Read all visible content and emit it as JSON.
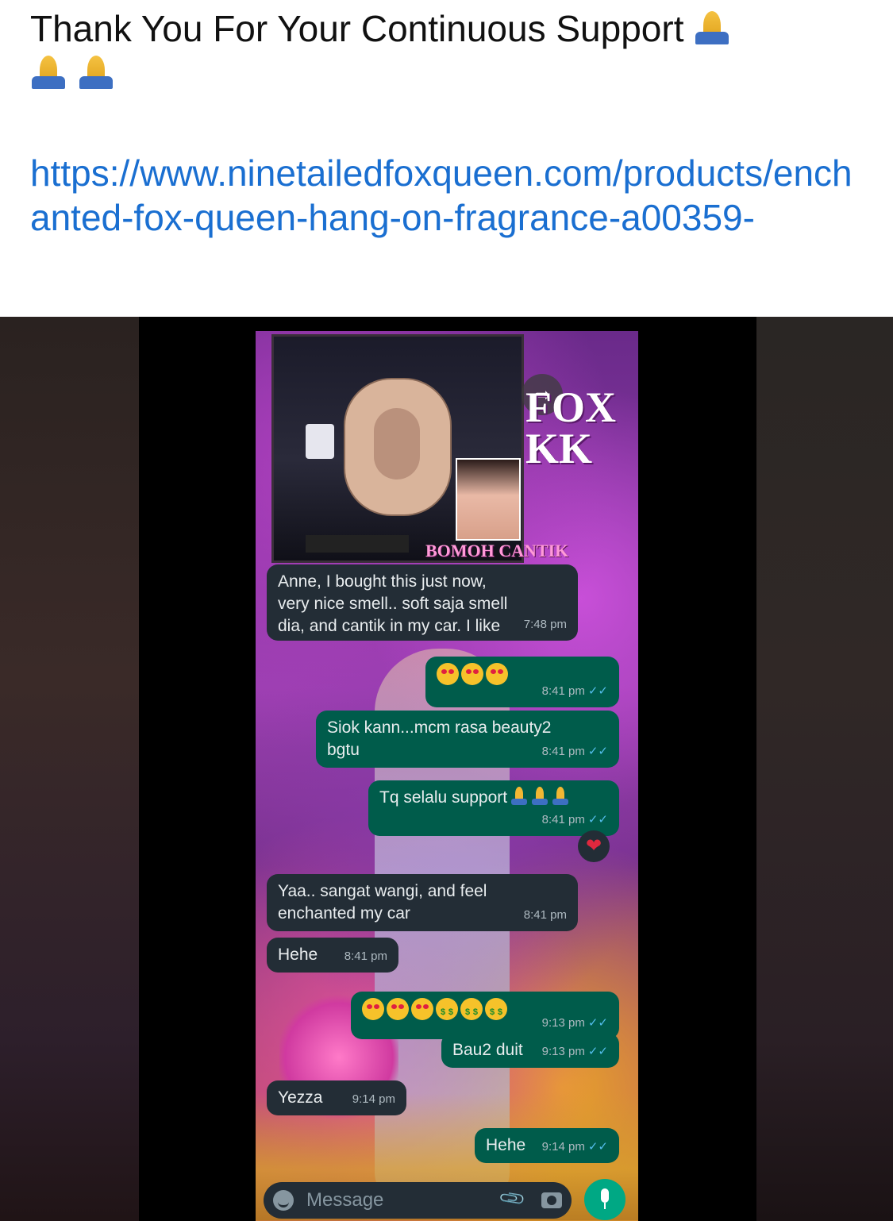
{
  "post": {
    "caption": "Thank You For Your Continuous Support",
    "link": "https://www.ninetailedfoxqueen.com/products/enchanted-fox-queen-hang-on-fragrance-a00359-"
  },
  "overlay": {
    "fox_title_1": "FOX",
    "fox_title_2": "KK",
    "brand": "BOMOH CANTIK"
  },
  "messages": [
    {
      "side": "in",
      "text": "Anne, I bought this just now, very nice smell.. soft saja smell dia, and cantik in my car. I like",
      "time": "7:48 pm"
    },
    {
      "side": "out",
      "text": "",
      "time": "8:41 pm"
    },
    {
      "side": "out",
      "text": "Siok kann...mcm rasa beauty2 bgtu",
      "time": "8:41 pm"
    },
    {
      "side": "out",
      "text": "Tq selalu support",
      "time": "8:41 pm"
    },
    {
      "side": "in",
      "text": "Yaa..  sangat wangi, and feel enchanted my car",
      "time": "8:41 pm"
    },
    {
      "side": "in",
      "text": "Hehe",
      "time": "8:41 pm"
    },
    {
      "side": "out",
      "text": "",
      "time": "9:13 pm"
    },
    {
      "side": "out",
      "text": "Bau2 duit",
      "time": "9:13 pm"
    },
    {
      "side": "in",
      "text": "Yezza",
      "time": "9:14 pm"
    },
    {
      "side": "out",
      "text": "Hehe",
      "time": "9:14 pm"
    }
  ],
  "reaction": "❤",
  "composer": {
    "placeholder": "Message"
  },
  "icons": [
    "folded-hands-icon",
    "forward-icon",
    "emoji-icon",
    "attach-icon",
    "camera-icon",
    "mic-icon",
    "double-check-icon"
  ]
}
